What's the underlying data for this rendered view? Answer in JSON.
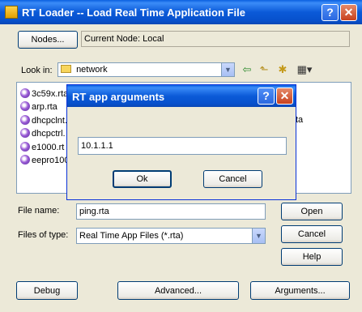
{
  "main": {
    "title": "RT Loader -- Load Real Time Application File",
    "help_glyph": "?",
    "close_glyph": "✕",
    "nodes_button": "Nodes...",
    "current_node": "Current Node:  Local",
    "look_in_label": "Look in:",
    "look_in_value": "network",
    "files": [
      "3c59x.rta",
      "arp.rta",
      "dhcpclnt.",
      "dhcpctrl.",
      "e1000.rt",
      "eepro100"
    ],
    "hidden_right_fragment": "ta",
    "file_name_label": "File name:",
    "file_name_value": "ping.rta",
    "files_of_type_label": "Files of type:",
    "files_of_type_value": "Real Time App Files (*.rta)",
    "open_button": "Open",
    "cancel_button": "Cancel",
    "help_button": "Help",
    "debug_button": "Debug",
    "advanced_button": "Advanced...",
    "arguments_button": "Arguments..."
  },
  "dialog": {
    "title": "RT app arguments",
    "help_glyph": "?",
    "close_glyph": "✕",
    "input_value": "10.1.1.1",
    "ok_button": "Ok",
    "cancel_button": "Cancel"
  },
  "icons": {
    "back": "back-arrow-icon",
    "up": "up-folder-icon",
    "new_folder": "new-folder-icon",
    "view_menu": "view-menu-icon"
  },
  "colors": {
    "titlebar": "#0a5fe0",
    "dialog_bg": "#ece9d8",
    "close_button": "#c8411e"
  }
}
